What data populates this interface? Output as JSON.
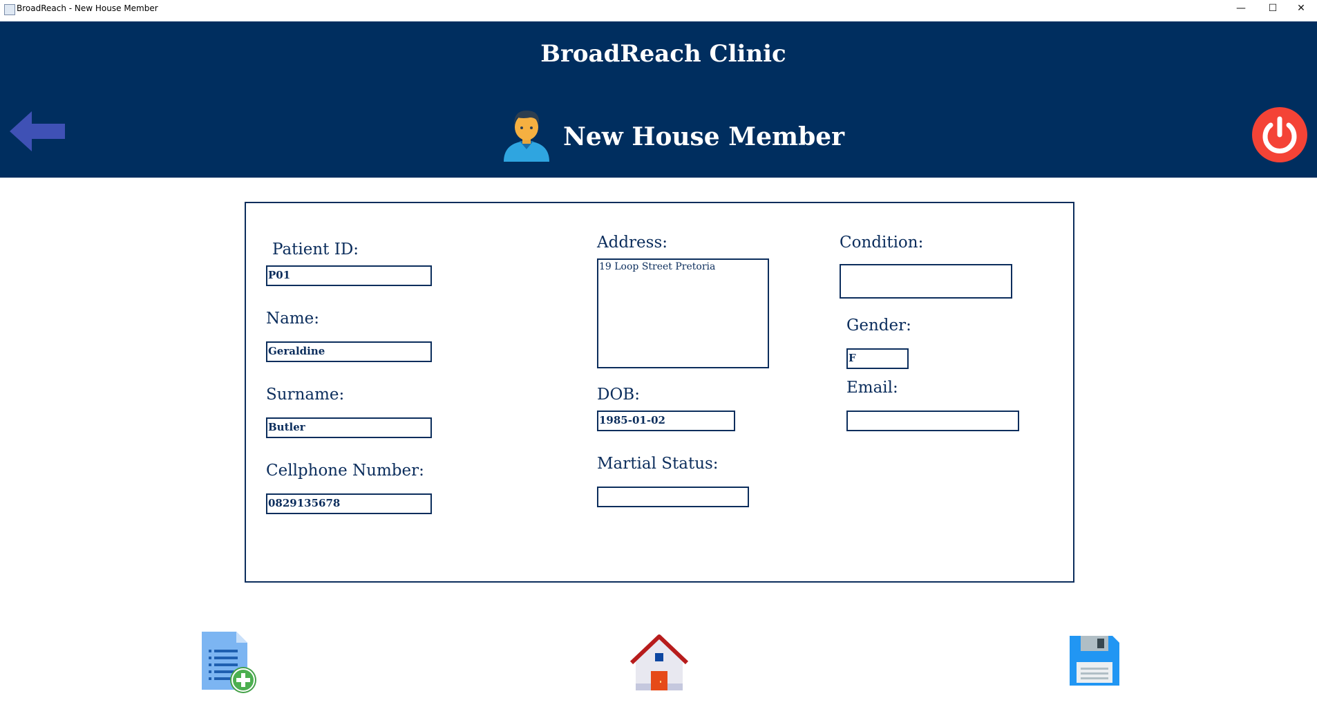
{
  "window": {
    "title": "BroadReach - New House Member",
    "minimize_glyph": "—",
    "maximize_glyph": "☐",
    "close_glyph": "✕"
  },
  "header": {
    "clinic_name": "BroadReach Clinic",
    "page_title": "New House Member",
    "background_color": "#002e5f",
    "back_icon": "back-arrow-icon",
    "logout_icon": "power-icon",
    "page_icon": "person-icon"
  },
  "form": {
    "patient_id": {
      "label": "Patient ID:",
      "value": "P01"
    },
    "name": {
      "label": "Name:",
      "value": "Geraldine"
    },
    "surname": {
      "label": "Surname:",
      "value": "Butler"
    },
    "cellphone": {
      "label": "Cellphone Number:",
      "value": "0829135678"
    },
    "address": {
      "label": "Address:",
      "value": "19 Loop Street Pretoria"
    },
    "dob": {
      "label": "DOB:",
      "value": "1985-01-02"
    },
    "marital_status": {
      "label": "Martial Status:",
      "value": ""
    },
    "condition": {
      "label": "Condition:",
      "value": ""
    },
    "gender": {
      "label": "Gender:",
      "value": "F"
    },
    "email": {
      "label": "Email:",
      "value": ""
    }
  },
  "footer": {
    "add_icon": "add-document-icon",
    "home_icon": "home-icon",
    "save_icon": "floppy-disk-icon"
  },
  "colors": {
    "navy": "#002e5f",
    "back_arrow": "#3f51b5",
    "power": "#f44336"
  }
}
